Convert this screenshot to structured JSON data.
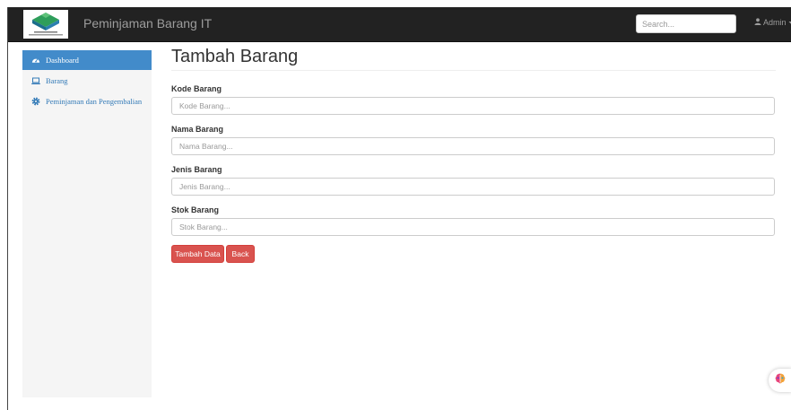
{
  "app": {
    "brand": "Peminjaman Barang IT"
  },
  "header": {
    "search_placeholder": "Search...",
    "user_label": "Admin"
  },
  "sidebar": {
    "items": [
      {
        "label": "Dashboard",
        "icon": "dashboard-icon",
        "active": true
      },
      {
        "label": "Barang",
        "icon": "laptop-icon",
        "active": false
      },
      {
        "label": "Peminjaman dan Pengembalian",
        "icon": "gear-icon",
        "active": false
      }
    ]
  },
  "main": {
    "title": "Tambah Barang",
    "fields": [
      {
        "label": "Kode Barang",
        "placeholder": "Kode Barang..."
      },
      {
        "label": "Nama Barang",
        "placeholder": "Nama Barang..."
      },
      {
        "label": "Jenis Barang",
        "placeholder": "Jenis Barang..."
      },
      {
        "label": "Stok Barang",
        "placeholder": "Stok Barang..."
      }
    ],
    "submit_label": "Tambah Data",
    "back_label": "Back"
  },
  "colors": {
    "navbar": "#222222",
    "sidebar_active": "#428bca",
    "button_danger": "#d9534f"
  }
}
